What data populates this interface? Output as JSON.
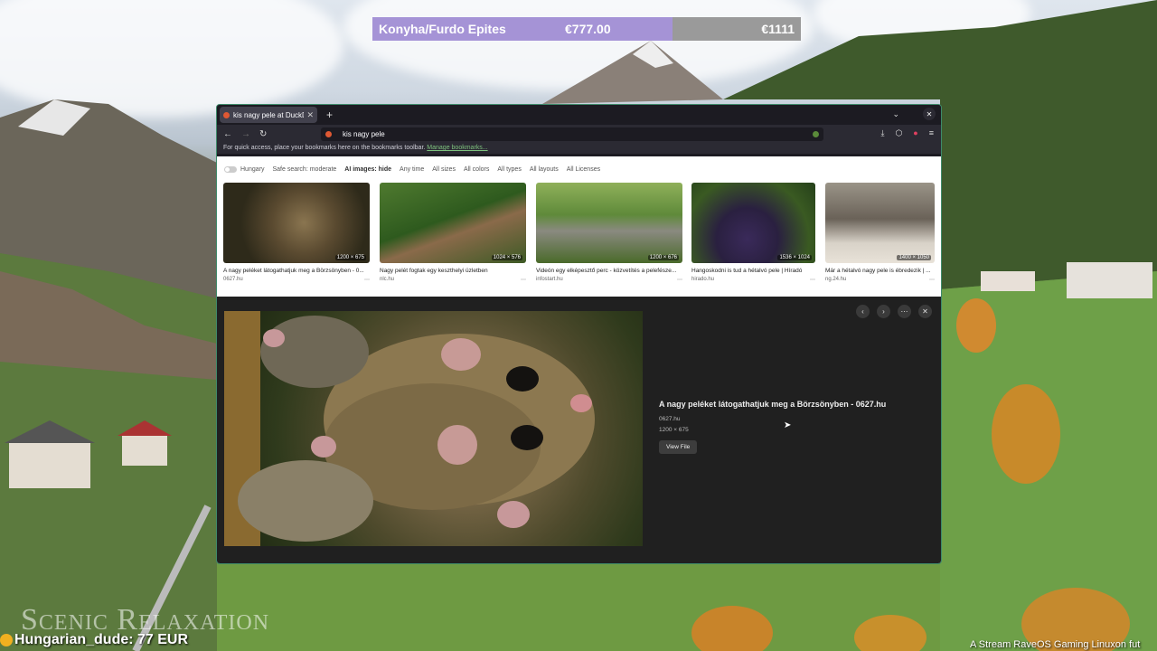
{
  "goal": {
    "title": "Konyha/Furdo Epites",
    "current": "€777.00",
    "target": "€1111",
    "progress": 0.7
  },
  "browser": {
    "tab_title": "kis nagy pele at DuckDu",
    "url": "kis nagy pele",
    "bookmarks_text": "For quick access, place your bookmarks here on the bookmarks toolbar.",
    "bookmarks_link": "Manage bookmarks..."
  },
  "filters": [
    "Hungary",
    "Safe search: moderate",
    "AI images: hide",
    "Any time",
    "All sizes",
    "All colors",
    "All types",
    "All layouts",
    "All Licenses"
  ],
  "results": [
    {
      "dims": "1200 × 675",
      "caption": "A nagy peléket látogathatjuk meg a Börzsönyben - 0...",
      "source": "0627.hu"
    },
    {
      "dims": "1024 × 576",
      "caption": "Nagy pelét fogtak egy keszthelyi üzletben",
      "source": "nlc.hu"
    },
    {
      "dims": "1200 × 676",
      "caption": "Videón egy elképesztő perc - közvetítés a pelefésze...",
      "source": "infostart.hu"
    },
    {
      "dims": "1536 × 1024",
      "caption": "Hangoskodni is tud a hétalvó pele | Híradó",
      "source": "hirado.hu"
    },
    {
      "dims": "1400 × 1050",
      "caption": "Már a hétalvó nagy pele is ébredezik | ...",
      "source": "ng.24.hu"
    }
  ],
  "detail": {
    "title": "A nagy peléket látogathatjuk meg a Börzsönyben - 0627.hu",
    "source": "0627.hu",
    "dims": "1200 × 675",
    "button": "View File"
  },
  "overlay": {
    "brand": "Scenic Relaxation",
    "donor": "Hungarian_dude: 77 EUR",
    "ticker": "A Stream RaveOS Gaming Linuxon fut"
  },
  "icons": [
    "back-icon",
    "forward-icon",
    "reload-icon",
    "download-icon",
    "extensions-icon",
    "menu-icon",
    "close-icon",
    "prev-icon",
    "next-icon",
    "more-icon"
  ]
}
